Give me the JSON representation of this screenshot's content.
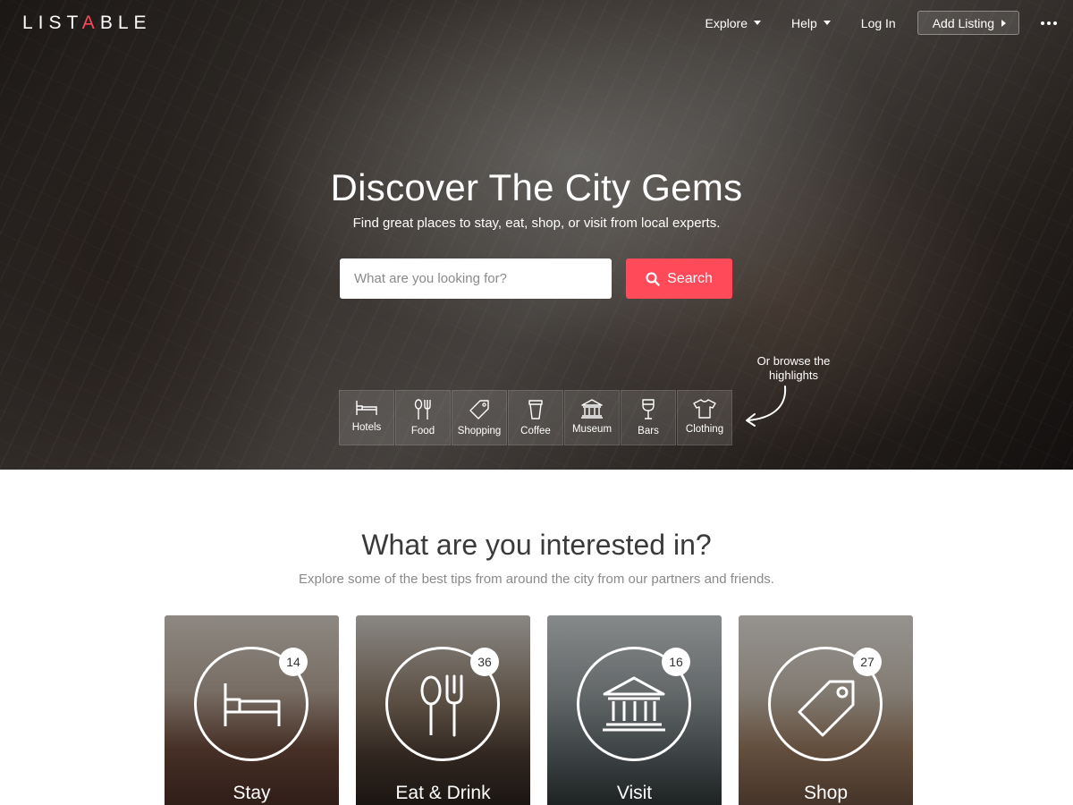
{
  "brand": {
    "logo_prefix": "LIST",
    "logo_accent": "A",
    "logo_suffix": "BLE",
    "accent_color": "#ff4a5a"
  },
  "nav": {
    "explore": "Explore",
    "help": "Help",
    "login": "Log In",
    "add_listing": "Add Listing",
    "more_icon": "more-dots-icon"
  },
  "hero": {
    "title": "Discover The City Gems",
    "subtitle": "Find great places to stay, eat, shop, or visit from local experts.",
    "search_placeholder": "What are you looking for?",
    "search_value": "",
    "search_button": "Search",
    "browse_hint": "Or browse the highlights",
    "categories": [
      {
        "label": "Hotels",
        "icon": "bed-icon"
      },
      {
        "label": "Food",
        "icon": "fork-spoon-icon"
      },
      {
        "label": "Shopping",
        "icon": "tag-icon"
      },
      {
        "label": "Coffee",
        "icon": "coffee-cup-icon"
      },
      {
        "label": "Museum",
        "icon": "museum-icon"
      },
      {
        "label": "Bars",
        "icon": "wine-glass-icon"
      },
      {
        "label": "Clothing",
        "icon": "tshirt-icon"
      }
    ]
  },
  "section": {
    "title": "What are you interested in?",
    "subtitle": "Explore some of the best tips from around the city from our partners and friends.",
    "cards": [
      {
        "label": "Stay",
        "count": "14",
        "icon": "bed-icon"
      },
      {
        "label": "Eat & Drink",
        "count": "36",
        "icon": "fork-spoon-icon"
      },
      {
        "label": "Visit",
        "count": "16",
        "icon": "museum-icon"
      },
      {
        "label": "Shop",
        "count": "27",
        "icon": "tag-icon"
      }
    ]
  }
}
